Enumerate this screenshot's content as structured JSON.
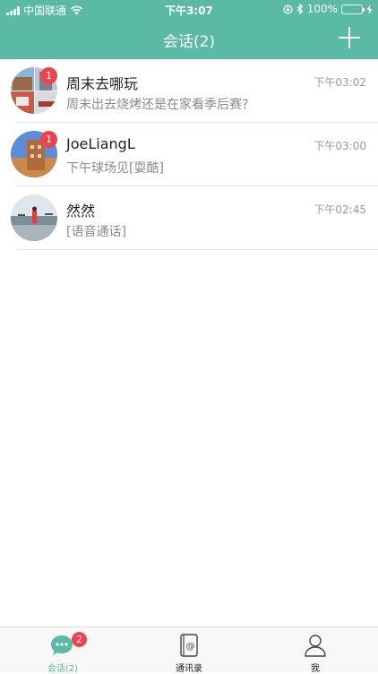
{
  "status_bar": {
    "carrier": "中国联通",
    "time": "下午3:07",
    "battery": "100%"
  },
  "header": {
    "title": "会话(2)"
  },
  "conversations": [
    {
      "name": "周末去哪玩",
      "time": "下午03:02",
      "preview": "周末出去烧烤还是在家看季后赛?",
      "badge": "1"
    },
    {
      "name": "JoeLiangL",
      "time": "下午03:00",
      "preview": "下午球场见[耍酷]",
      "badge": "1"
    },
    {
      "name": "然然",
      "time": "下午02:45",
      "preview": "[语音通话]",
      "badge": ""
    }
  ],
  "tabbar": {
    "tabs": [
      {
        "label": "会话(2)",
        "badge": "2",
        "icon": "chat-bubble-icon",
        "active": true
      },
      {
        "label": "通讯录",
        "icon": "address-book-icon",
        "active": false
      },
      {
        "label": "我",
        "icon": "person-icon",
        "active": false
      }
    ]
  },
  "colors": {
    "accent": "#5bbaa6",
    "badge": "#f0424a"
  }
}
